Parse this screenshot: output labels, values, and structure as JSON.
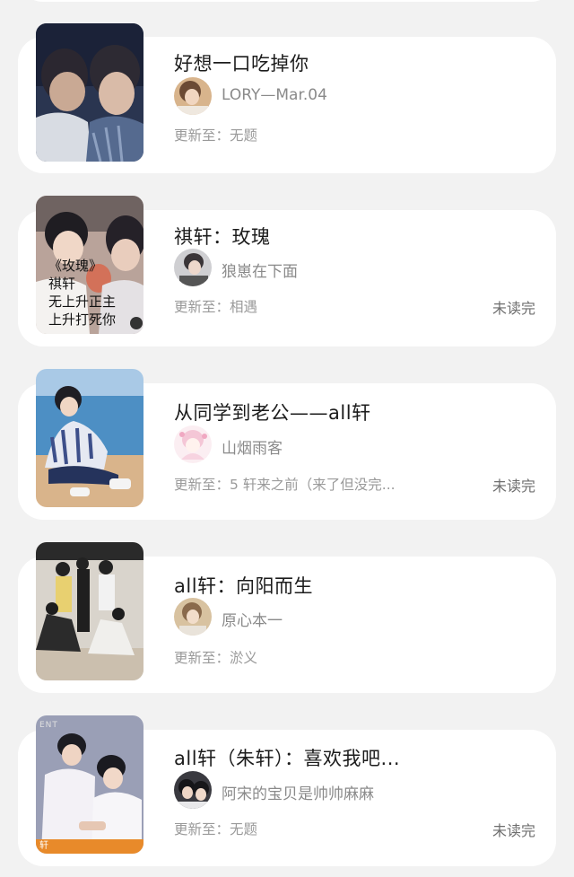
{
  "books": [
    {
      "title": "好想一口吃掉你",
      "author": "LORY—Mar.04",
      "update_label": "更新至：",
      "update_chapter": "无题",
      "unread": ""
    },
    {
      "title": "祺轩：玫瑰",
      "author": "狼崽在下面",
      "update_label": "更新至：",
      "update_chapter": "相遇",
      "unread": "未读完",
      "cover_text": "《玫瑰》\n祺轩\n无上升正主\n上升打死你"
    },
    {
      "title": "从同学到老公——all轩",
      "author": "山烟雨客",
      "update_label": "更新至：",
      "update_chapter": "5 轩来之前（来了但没完...",
      "unread": "未读完"
    },
    {
      "title": "all轩：向阳而生",
      "author": "原心本一",
      "update_label": "更新至：",
      "update_chapter": "淤义",
      "unread": ""
    },
    {
      "title": "all轩（朱轩）：喜欢我吧...",
      "author": "阿宋的宝贝是帅帅麻麻",
      "update_label": "更新至：",
      "update_chapter": "无题",
      "unread": "未读完",
      "cover_corner": "ENT",
      "cover_strip": "轩"
    }
  ],
  "colors": {
    "background": "#f2f2f2",
    "card": "#ffffff",
    "title": "#1c1c1c",
    "meta": "#9a9a9a"
  }
}
